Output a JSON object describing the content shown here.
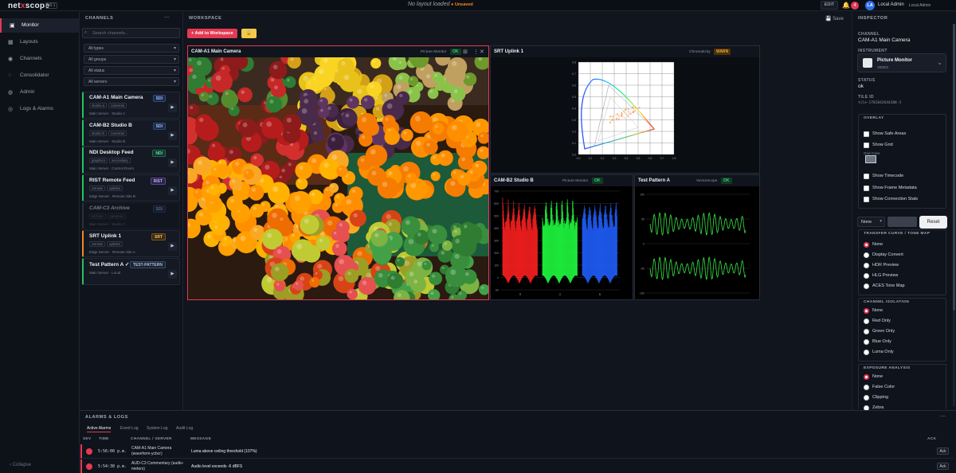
{
  "app": {
    "logo_a": "net",
    "logo_x": "x",
    "logo_b": "scope",
    "version": "v0.1",
    "layout_status": "No layout loaded",
    "unsaved": "● Unsaved",
    "edit": "EDIT",
    "notifications": "4",
    "user_initials": "LA",
    "user_name": "Local Admin",
    "user_role": "Local Admin"
  },
  "nav": {
    "items": [
      {
        "label": "Monitor",
        "icon": "monitor-icon",
        "glyph": "▣"
      },
      {
        "label": "Layouts",
        "icon": "layouts-icon",
        "glyph": "▦"
      },
      {
        "label": "Channels",
        "icon": "channels-icon",
        "glyph": "◉"
      },
      {
        "label": "Consolidator",
        "icon": "consolidator-icon",
        "glyph": "◌"
      },
      {
        "label": "Admin",
        "icon": "admin-icon",
        "glyph": "◍"
      },
      {
        "label": "Logs & Alarms",
        "icon": "logs-icon",
        "glyph": "◎"
      }
    ],
    "collapse": "‹  Collapse"
  },
  "channels": {
    "title": "CHANNELS",
    "search_placeholder": "Search channels...",
    "filters": [
      "All types",
      "All groups",
      "All status",
      "All servers"
    ],
    "items": [
      {
        "name": "CAM-A1 Main Camera",
        "badge": "SDI",
        "tags": [
          "studio-a",
          "cameras"
        ],
        "source": "Main Server · Studio A"
      },
      {
        "name": "CAM-B2 Studio B",
        "badge": "SDI",
        "tags": [
          "studio-b",
          "cameras"
        ],
        "source": "Main Server · Studio B"
      },
      {
        "name": "NDI Desktop Feed",
        "badge": "NDI",
        "tags": [
          "graphics",
          "secondary"
        ],
        "source": "Main Server · Control Room"
      },
      {
        "name": "RIST Remote Feed",
        "badge": "RIST",
        "tags": [
          "remote",
          "uplinks"
        ],
        "source": "Edge Server · Remote Site B"
      },
      {
        "name": "CAM-C3 Archive",
        "badge": "SDI",
        "tags": [
          "archive",
          "cameras"
        ],
        "source": "Main Server · Studio C"
      },
      {
        "name": "SRT Uplink 1",
        "badge": "SRT",
        "tags": [
          "remote",
          "uplinks"
        ],
        "source": "Edge Server · Remote Site A"
      },
      {
        "name": "Test Pattern A ✓",
        "badge": "TEST-PATTERN",
        "tags": [],
        "source": "Main Server · Local"
      }
    ]
  },
  "workspace": {
    "title": "WORKSPACE",
    "add_button": "+ Add to Workspace",
    "lock_icon": "🔒",
    "save": "💾 Save"
  },
  "tiles": [
    {
      "name": "CAM-A1 Main Camera",
      "instrument": "Picture Monitor",
      "status": "OK"
    },
    {
      "name": "SRT Uplink 1",
      "instrument": "Chromaticity",
      "status": "WARN"
    },
    {
      "name": "CAM-B2 Studio B",
      "instrument": "Picture Monitor",
      "status": "OK"
    },
    {
      "name": "Test Pattern A",
      "instrument": "Vectorscope",
      "status": "OK"
    }
  ],
  "cie_ticks_y": [
    "0.8",
    "0.7",
    "0.6",
    "0.5",
    "0.4",
    "0.3",
    "0.2",
    "0.1",
    "0.0"
  ],
  "cie_ticks_x": [
    "0.0",
    "0.1",
    "0.2",
    "0.3",
    "0.4",
    "0.5",
    "0.6",
    "0.7",
    "0.8"
  ],
  "wave_ticks": [
    "700",
    "600",
    "500",
    "400",
    "300",
    "200",
    "100",
    "0",
    "-50"
  ],
  "wave_ch": [
    "R",
    "G",
    "B"
  ],
  "vec_ticks": [
    "100",
    "50",
    "0",
    "-50",
    "-100"
  ],
  "inspector": {
    "title": "INSPECTOR",
    "channel_label": "CHANNEL",
    "channel": "CAM-A1 Main Camera",
    "instrument_label": "INSTRUMENT",
    "instrument": "Picture Monitor",
    "instrument_type": "VIDEO",
    "status_label": "STATUS",
    "status": "ok",
    "tile_label": "TILE ID",
    "tile_id": "tile-1781842644388-3",
    "overlay_title": "OVERLAY",
    "overlay": [
      "Show Safe Areas",
      "Show Grid",
      "Show Timecode",
      "Show Frame Metadata",
      "Show Connection Stats"
    ],
    "grid_color": "Grid Color",
    "select_none": "None",
    "reset": "Reset",
    "transfer_title": "TRANSFER CURVE / TONE MAP",
    "transfer": [
      "None",
      "Display Convert",
      "HDR Preview",
      "HLG Preview",
      "ACES Tone Map"
    ],
    "isolation_title": "CHANNEL ISOLATION",
    "isolation": [
      "None",
      "Red Only",
      "Green Only",
      "Blue Only",
      "Luma Only"
    ],
    "exposure_title": "EXPOSURE ANALYSIS",
    "exposure": [
      "None",
      "False Color",
      "Clipping",
      "Zebra"
    ]
  },
  "alarms": {
    "title": "ALARMS & LOGS",
    "tabs": [
      "Active Alarms",
      "Event Log",
      "System Log",
      "Audit Log"
    ],
    "cols": [
      "SEV",
      "TIME",
      "CHANNEL / SERVER",
      "MESSAGE",
      "ACK"
    ],
    "rows": [
      {
        "time": "5:56:00 p.m.",
        "channel": "CAM-A1 Main Camera (waveform-ycbcr)",
        "message": "Luma above ceiling threshold (107%)",
        "ack": "Ack"
      },
      {
        "time": "5:54:30 p.m.",
        "channel": "AUD-C3 Commentary (audio-meters)",
        "message": "Audio level exceeds -6 dBFS",
        "ack": "Ack"
      }
    ]
  },
  "colors": {
    "accent": "#e53953",
    "ok": "#35d07f",
    "warn": "#f5a524"
  }
}
